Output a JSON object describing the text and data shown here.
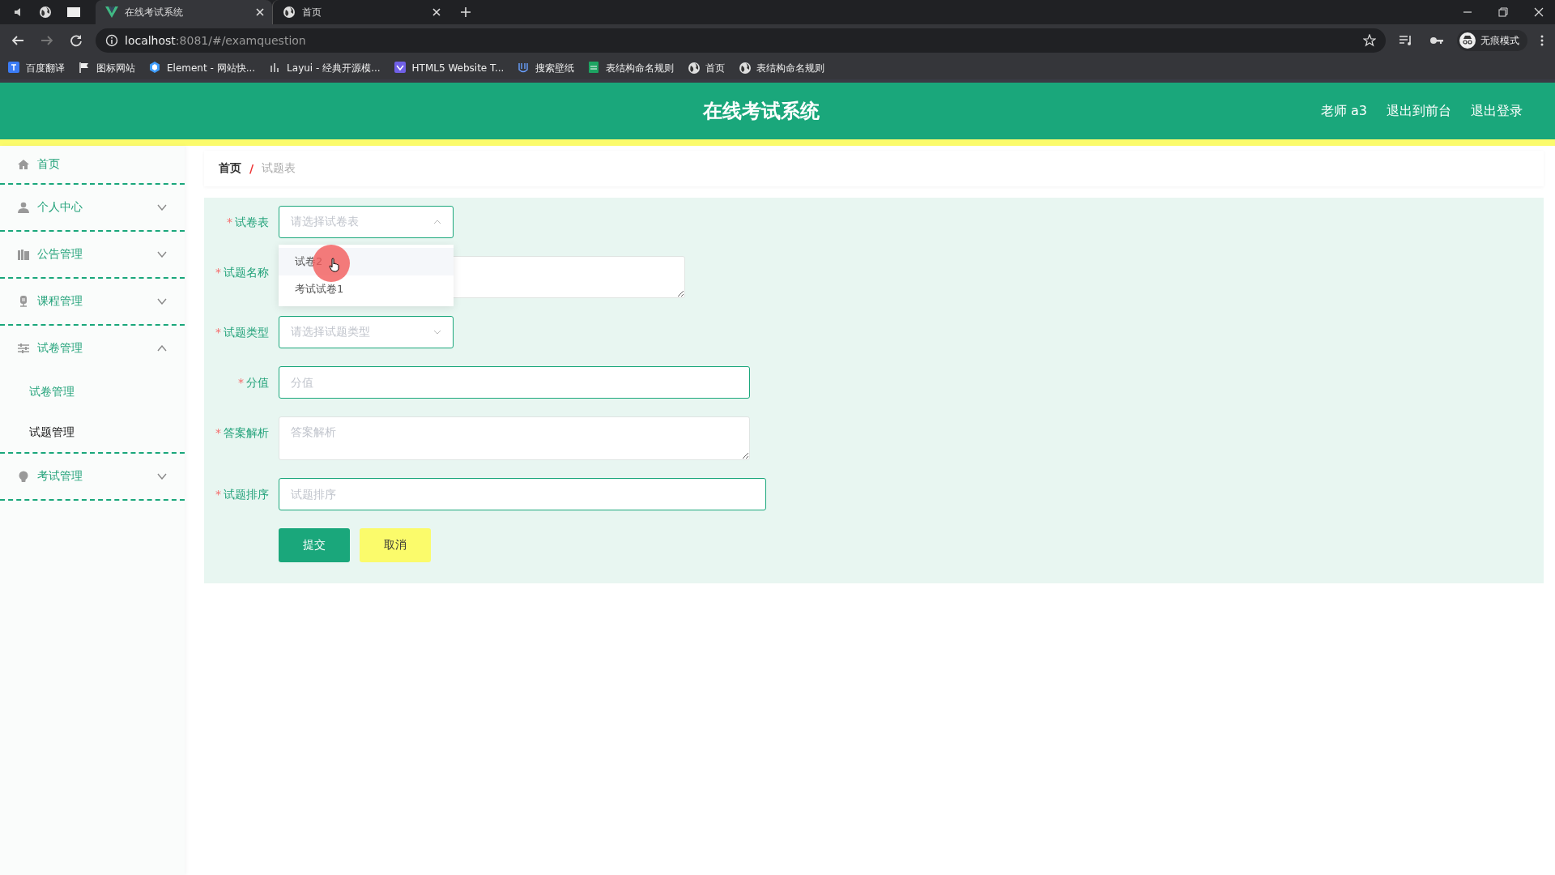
{
  "browser": {
    "tabs": [
      {
        "title": "在线考试系统",
        "selected": true
      },
      {
        "title": "首页",
        "selected": false
      }
    ],
    "address": {
      "host": "localhost",
      "rest": ":8081/#/examquestion"
    },
    "bookmarks": [
      "百度翻译",
      "图标网站",
      "Element - 网站快...",
      "Layui - 经典开源模...",
      "HTML5 Website T...",
      "搜索壁纸",
      "表结构命名规则",
      "首页",
      "表结构命名规则"
    ],
    "profile_label": "无痕模式"
  },
  "header": {
    "title": "在线考试系统",
    "links": [
      "老师 a3",
      "退出到前台",
      "退出登录"
    ]
  },
  "sidebar": {
    "items": [
      {
        "label": "首页",
        "kind": "link"
      },
      {
        "label": "个人中心",
        "kind": "group",
        "expanded": false
      },
      {
        "label": "公告管理",
        "kind": "group",
        "expanded": false
      },
      {
        "label": "课程管理",
        "kind": "group",
        "expanded": false
      },
      {
        "label": "试卷管理",
        "kind": "group",
        "expanded": true,
        "children": [
          {
            "label": "试卷管理",
            "selected": false
          },
          {
            "label": "试题管理",
            "selected": true
          }
        ]
      },
      {
        "label": "考试管理",
        "kind": "group",
        "expanded": false
      }
    ]
  },
  "breadcrumb": {
    "items": [
      "首页",
      "试题表"
    ],
    "separator": "/"
  },
  "form": {
    "fields": [
      {
        "label": "试卷表",
        "kind": "select",
        "placeholder": "请选择试卷表",
        "required_mark": "*",
        "expanded": true,
        "options": [
          {
            "label": "试卷2",
            "highlighted": true
          },
          {
            "label": "考试试卷1",
            "highlighted": false
          }
        ]
      },
      {
        "label": "试题名称",
        "kind": "textarea",
        "required_mark": "*"
      },
      {
        "label": "试题类型",
        "kind": "select",
        "placeholder": "请选择试题类型",
        "required_mark": "*",
        "expanded": false
      },
      {
        "label": "分值",
        "kind": "input",
        "placeholder": "分值",
        "required_mark": "*"
      },
      {
        "label": "答案解析",
        "kind": "textarea",
        "placeholder": "答案解析",
        "required_mark": "*"
      },
      {
        "label": "试题排序",
        "kind": "input",
        "placeholder": "试题排序",
        "required_mark": "*"
      }
    ],
    "buttons": [
      {
        "label": "提交",
        "kind": "primary"
      },
      {
        "label": "取消",
        "kind": "cancel"
      }
    ]
  }
}
